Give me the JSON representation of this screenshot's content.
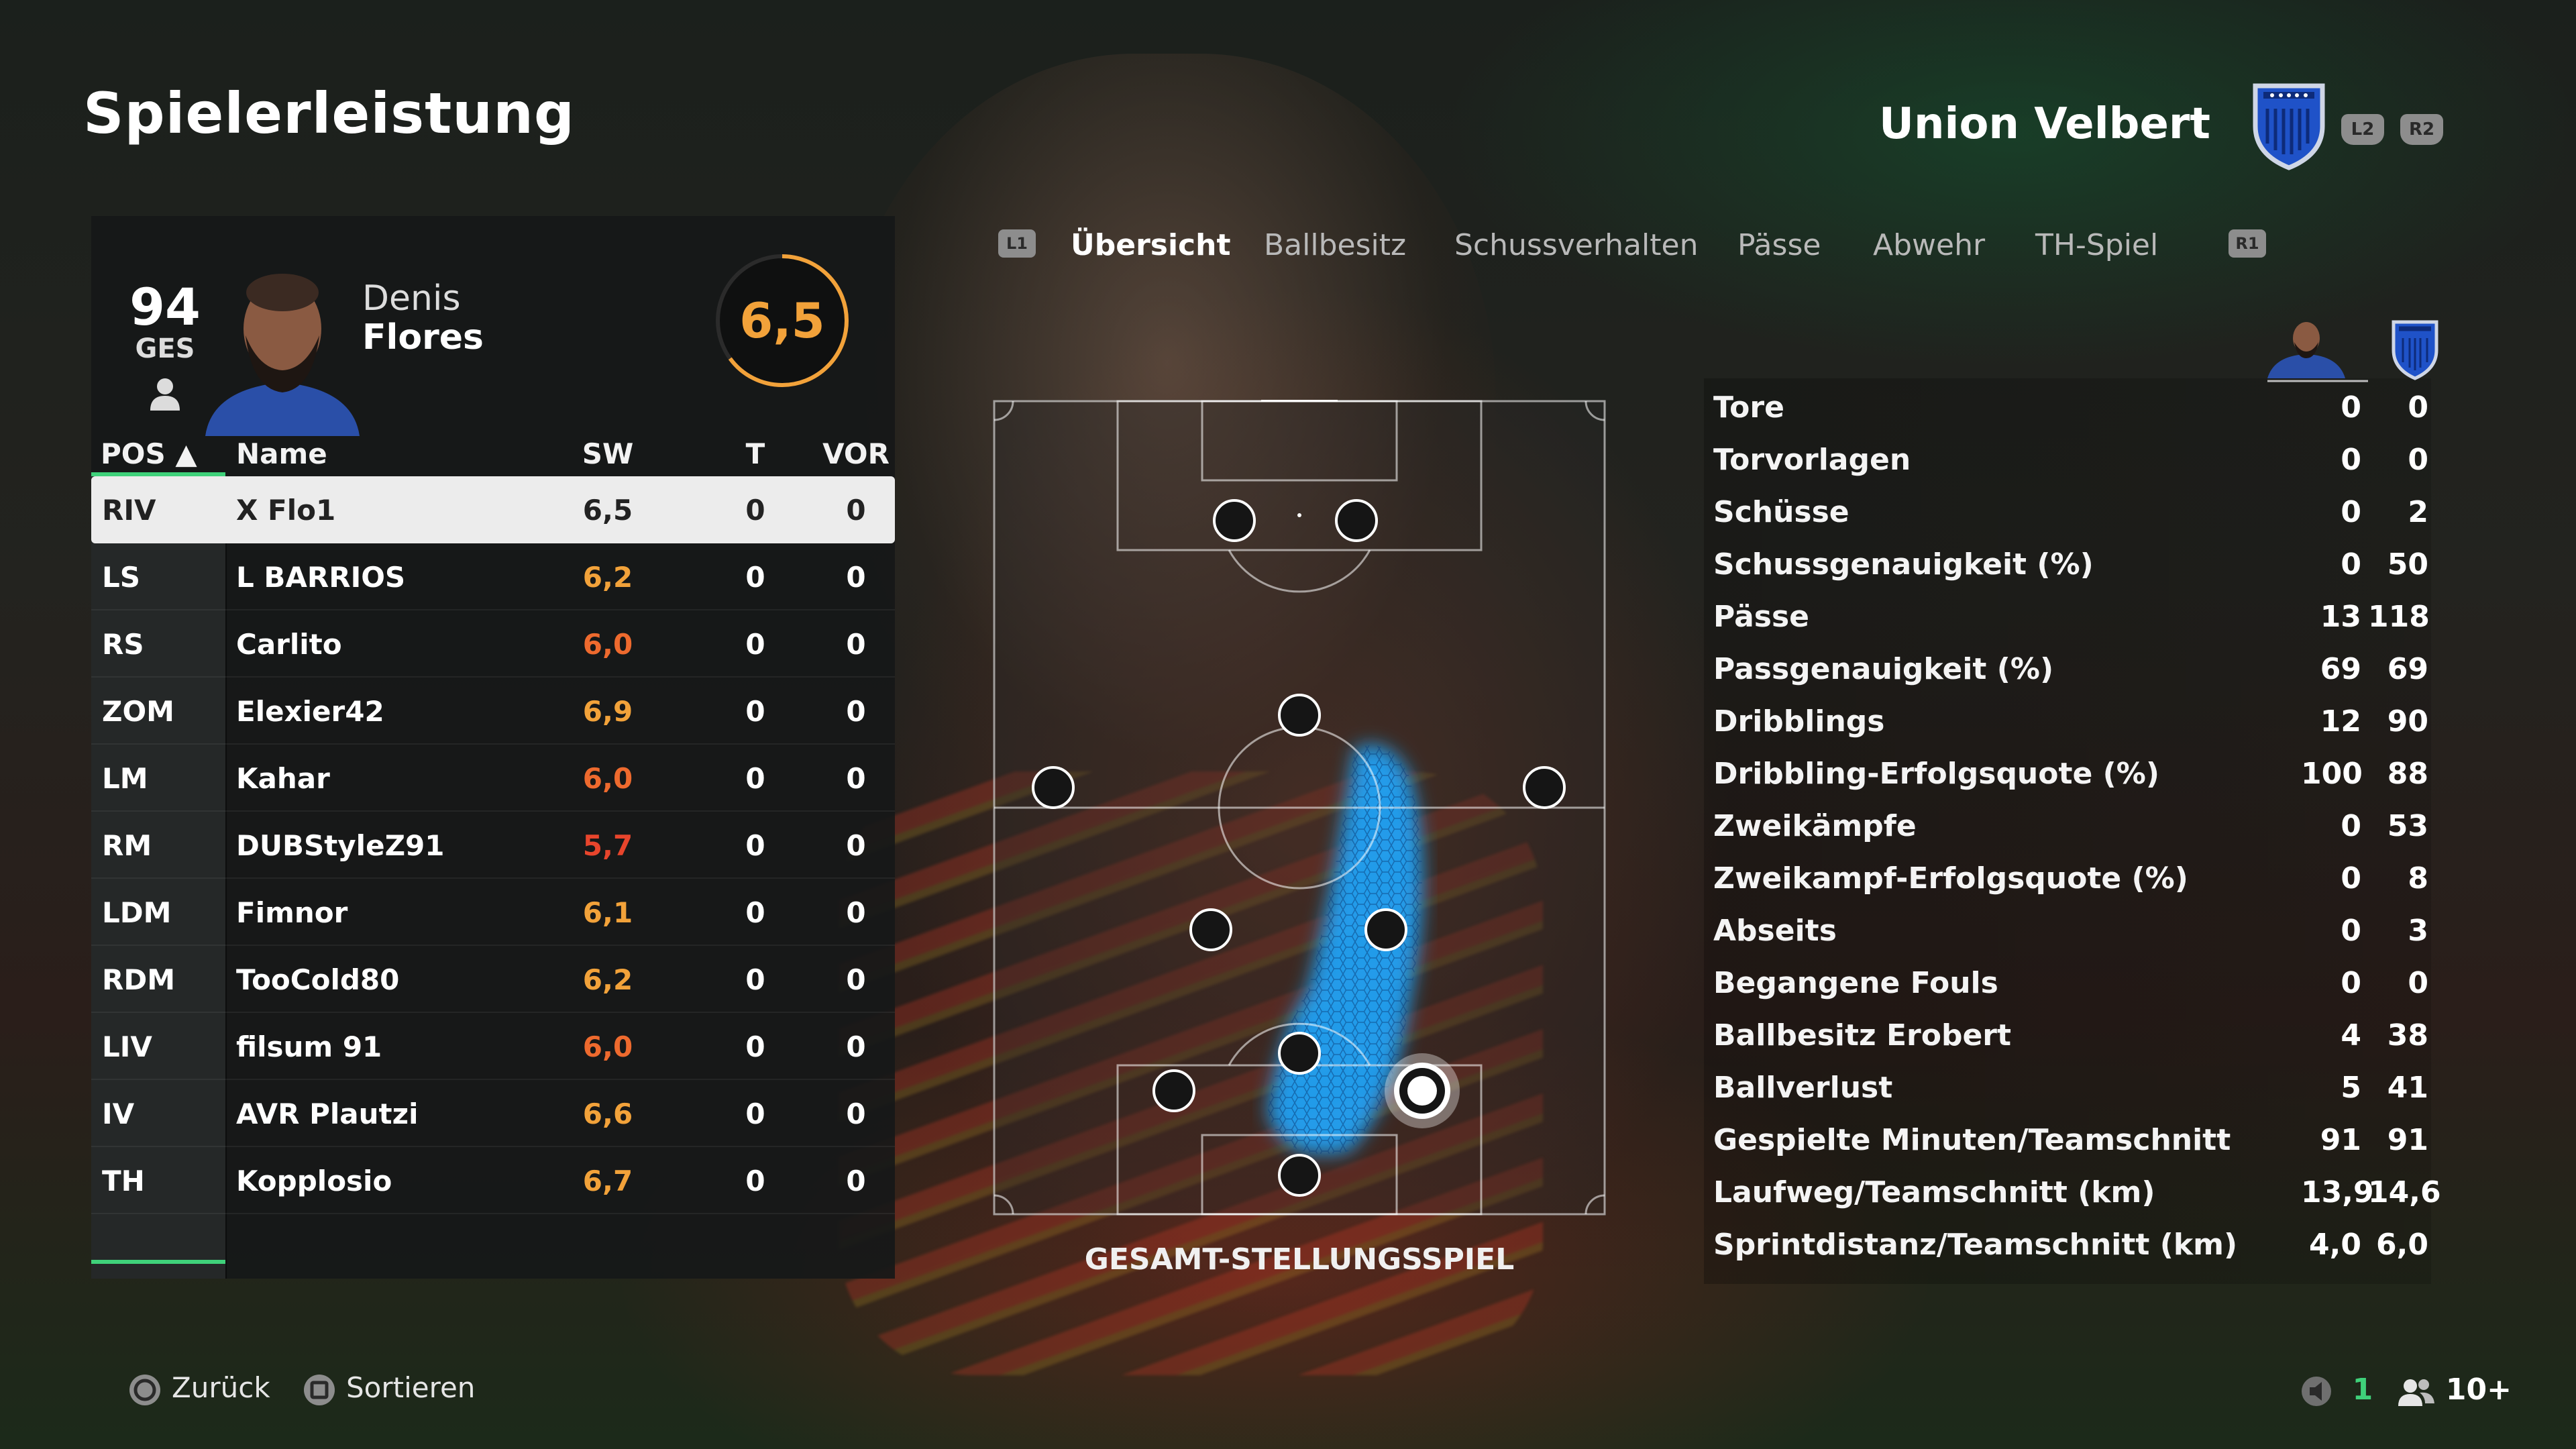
{
  "page": {
    "title": "Spielerleistung"
  },
  "team": {
    "name": "Union Velbert",
    "left_trigger": "L2",
    "right_trigger": "R2"
  },
  "player": {
    "overall": "94",
    "overall_label": "GES",
    "first_name": "Denis",
    "last_name": "Flores",
    "rating": "6,5",
    "rating_color": "#f2a23a"
  },
  "table": {
    "headers": {
      "pos": "POS ▲",
      "name": "Name",
      "sw": "SW",
      "t": "T",
      "vor": "VOR"
    },
    "rows": [
      {
        "pos": "RIV",
        "name": "X Flo1",
        "sw": "6,5",
        "t": "0",
        "vor": "0",
        "selected": true
      },
      {
        "pos": "LS",
        "name": "L BARRIOS",
        "sw": "6,2",
        "t": "0",
        "vor": "0"
      },
      {
        "pos": "RS",
        "name": "Carlito",
        "sw": "6,0",
        "t": "0",
        "vor": "0"
      },
      {
        "pos": "ZOM",
        "name": "Elexier42",
        "sw": "6,9",
        "t": "0",
        "vor": "0"
      },
      {
        "pos": "LM",
        "name": "Kahar",
        "sw": "6,0",
        "t": "0",
        "vor": "0"
      },
      {
        "pos": "RM",
        "name": "DUBStyleZ91",
        "sw": "5,7",
        "t": "0",
        "vor": "0"
      },
      {
        "pos": "LDM",
        "name": "Fimnor",
        "sw": "6,1",
        "t": "0",
        "vor": "0"
      },
      {
        "pos": "RDM",
        "name": "TooCold80",
        "sw": "6,2",
        "t": "0",
        "vor": "0"
      },
      {
        "pos": "LIV",
        "name": "filsum 91",
        "sw": "6,0",
        "t": "0",
        "vor": "0"
      },
      {
        "pos": "IV",
        "name": "AVR Plautzi",
        "sw": "6,6",
        "t": "0",
        "vor": "0"
      },
      {
        "pos": "TH",
        "name": "Kopplosio",
        "sw": "6,7",
        "t": "0",
        "vor": "0"
      }
    ]
  },
  "tabs": {
    "left_button": "L1",
    "right_button": "R1",
    "items": [
      "Übersicht",
      "Ballbesitz",
      "Schussverhalten",
      "Pässe",
      "Abwehr",
      "TH-Spiel"
    ],
    "active": "Übersicht"
  },
  "pitch": {
    "caption": "GESAMT-STELLUNGSSPIEL"
  },
  "stats": [
    {
      "label": "Tore",
      "player": "0",
      "team": "0"
    },
    {
      "label": "Torvorlagen",
      "player": "0",
      "team": "0"
    },
    {
      "label": "Schüsse",
      "player": "0",
      "team": "2"
    },
    {
      "label": "Schussgenauigkeit (%)",
      "player": "0",
      "team": "50"
    },
    {
      "label": "Pässe",
      "player": "13",
      "team": "118"
    },
    {
      "label": "Passgenauigkeit (%)",
      "player": "69",
      "team": "69"
    },
    {
      "label": "Dribblings",
      "player": "12",
      "team": "90"
    },
    {
      "label": "Dribbling-Erfolgsquote (%)",
      "player": "100",
      "team": "88"
    },
    {
      "label": "Zweikämpfe",
      "player": "0",
      "team": "53"
    },
    {
      "label": "Zweikampf-Erfolgsquote (%)",
      "player": "0",
      "team": "8"
    },
    {
      "label": "Abseits",
      "player": "0",
      "team": "3"
    },
    {
      "label": "Begangene Fouls",
      "player": "0",
      "team": "0"
    },
    {
      "label": "Ballbesitz Erobert",
      "player": "4",
      "team": "38"
    },
    {
      "label": "Ballverlust",
      "player": "5",
      "team": "41"
    },
    {
      "label": "Gespielte Minuten/Teamschnitt",
      "player": "91",
      "team": "91"
    },
    {
      "label": "Laufweg/Teamschnitt (km)",
      "player": "13,9",
      "team": "14,6"
    },
    {
      "label": "Sprintdistanz/Teamschnitt (km)",
      "player": "4,0",
      "team": "6,0"
    }
  ],
  "footer": {
    "back": {
      "icon": "circle-button-icon",
      "label": "Zurück"
    },
    "sort": {
      "icon": "square-button-icon",
      "label": "Sortieren"
    }
  },
  "status": {
    "voice_count": "1",
    "players": "10+"
  },
  "colors": {
    "accent_green": "#3fd17a",
    "rating_orange": "#f2a23a",
    "rating_red": "#e8452c",
    "heatmap_blue": "#1ea7ff"
  }
}
